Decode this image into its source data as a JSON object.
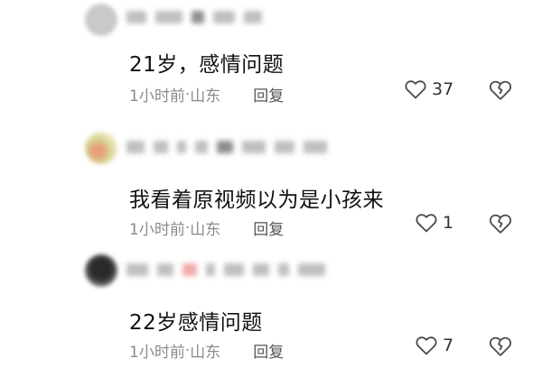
{
  "comments": [
    {
      "text": "21岁，感情问题",
      "time": "1小时前",
      "sep": " · ",
      "location": "山东",
      "reply_label": "回复",
      "likes": "37"
    },
    {
      "text": "我看着原视频以为是小孩来",
      "time": "1小时前",
      "sep": " · ",
      "location": "山东",
      "reply_label": "回复",
      "likes": "1"
    },
    {
      "text": "22岁感情问题",
      "time": "1小时前",
      "sep": " · ",
      "location": "山东",
      "reply_label": "回复",
      "likes": "7"
    }
  ],
  "icons": {
    "like": "heart-outline-icon",
    "dislike": "broken-heart-icon"
  },
  "colors": {
    "text": "#111111",
    "meta": "#8a8a8a",
    "reply": "#555555"
  }
}
